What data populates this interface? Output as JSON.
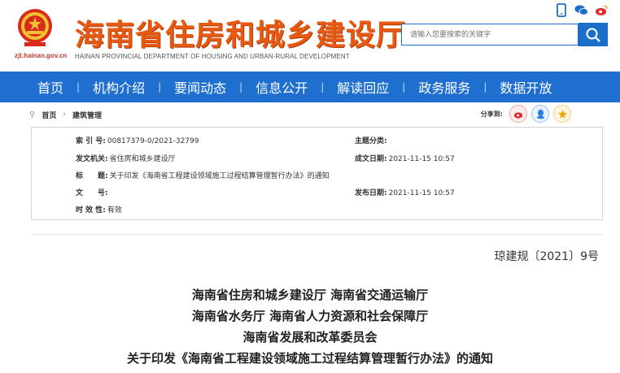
{
  "header": {
    "title": "海南省住房和城乡建设厅",
    "subtitle": "HAINAN PROVINCIAL DEPARTMENT OF HOUSING AND URBAN-RURAL DEVELOPMENT",
    "domain": "zjt.hainan.gov.cn",
    "search_placeholder": "请输入您要搜索的关键字",
    "icons": [
      "mobile-icon",
      "wechat-icon",
      "weibo-icon"
    ]
  },
  "nav": {
    "items": [
      "首页",
      "机构介绍",
      "要闻动态",
      "信息公开",
      "解读回应",
      "政务服务",
      "数据开放"
    ]
  },
  "breadcrumb": {
    "items": [
      "首页",
      "建筑管理"
    ],
    "share_label": "分享到:"
  },
  "meta": {
    "index_label": "索 引 号:",
    "index_value": "00817379-0/2021-32799",
    "topic_label": "主题分类:",
    "topic_value": "",
    "issuer_label": "发文机关:",
    "issuer_value": "省住房和城乡建设厅",
    "written_label": "成文日期:",
    "written_value": "2021-11-15 10:57",
    "title_label": "标　　题:",
    "title_value": "关于印发《海南省工程建设领域施工过程结算管理暂行办法》的通知",
    "docno_label": "文　　号:",
    "docno_value": "",
    "published_label": "发布日期:",
    "published_value": "2021-11-15 10:57",
    "validity_label": "时 效 性:",
    "validity_value": "有效"
  },
  "document": {
    "number": "琼建规〔2021〕9号",
    "heading_lines": [
      "海南省住房和城乡建设厅 海南省交通运输厅",
      "海南省水务厅 海南省人力资源和社会保障厅",
      "海南省发展和改革委员会",
      "关于印发《海南省工程建设领域施工过程结算管理暂行办法》的通知"
    ]
  },
  "colors": {
    "brand_blue": "#1f6fd1",
    "title_orange": "#e85a12"
  }
}
